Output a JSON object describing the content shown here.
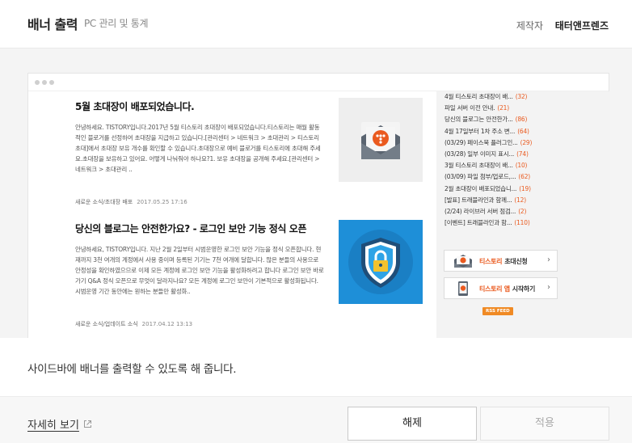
{
  "header": {
    "title": "배너 출력",
    "subtitle": "PC 관리 및 통계",
    "maker_label": "제작자",
    "maker_name": "태터앤프렌즈"
  },
  "preview": {
    "posts": [
      {
        "title": "5월 초대장이 배포되었습니다.",
        "body": "안녕하세요. TISTORY입니다.2017년 5월 티스토리 초대장이 배포되었습니다.티스토리는 매월 활동적인 블로거를 선정하여 초대장을 지급하고 있습니다.[관리센터 > 네트워크 > 초대관리 > 티스토리 초대]에서 초대장 보유 개수를 확인할 수 있습니다.초대장으로 예비 블로거를 티스토리에 초대해 주세요.초대장을 보유하고 있어요. 어떻게 나눠줘야 하나요?1. 보유 초대장을 공개해 주세요.[관리센터 > 네트워크 > 초대관리 ..",
        "category": "새로운 소식/초대장 배포",
        "date": "2017.05.25 17:16",
        "thumb_icon": "envelope-icon",
        "thumb_bg": "#eeeeee"
      },
      {
        "title": "당신의 블로그는 안전한가요? - 로그인 보안 기능 정식 오픈",
        "body": "안녕하세요, TISTORY입니다. 지난 2월 2일부터 시범운영한 로그인 보안 기능을 정식 오픈합니다. 현재까지 3천 여개의 계정에서 사용 중이며 등록된 기기는 7천 여개에 달합니다. 많은 분들의 사용으로 안정성을 확인하였으므로 이제 모든 계정에 로그인 보안 기능을 활성화하려고 합니다 로그인 보안 바로가기 Q&A 정식 오픈으로 무엇이 달라지나요? 모든 계정에 로그인 보안이 기본적으로 활성화됩니다. 시범운영 기간 동안에는 원하는 분들만 활성화..",
        "category": "새로운 소식/업데이트 소식",
        "date": "2017.04.12 13:13",
        "thumb_icon": "shield-lock-icon",
        "thumb_bg": "#1e8fd8"
      }
    ],
    "sidebar_list": [
      {
        "text": "4월 티스토리 초대장이 배...",
        "count": "(32)"
      },
      {
        "text": "파일 서버 이전 안내.",
        "count": "(21)"
      },
      {
        "text": "당신의 블로그는 안전한가...",
        "count": "(86)"
      },
      {
        "text": "4월 17일부터 1차 주소 변...",
        "count": "(64)"
      },
      {
        "text": "(03/29) 페이스북 플러그인...",
        "count": "(29)"
      },
      {
        "text": "(03/28) 일부 이미지 표시...",
        "count": "(74)"
      },
      {
        "text": "3월 티스토리 초대장이 배...",
        "count": "(10)"
      },
      {
        "text": "(03/09) 파일 첨부/업로드,...",
        "count": "(62)"
      },
      {
        "text": "2월 초대장이 배포되었습니...",
        "count": "(19)"
      },
      {
        "text": "[발표] 트래블라인과 함께...",
        "count": "(12)"
      },
      {
        "text": "(2/24) 라이브러 서버 점검...",
        "count": "(2)"
      },
      {
        "text": "[이벤트] 트래블라인과 함...",
        "count": "(110)"
      }
    ],
    "banner_invite": {
      "brand": "티스토리",
      "text": "초대신청"
    },
    "banner_app": {
      "brand": "티스토리 앱",
      "text": "시작하기"
    },
    "rss_label": "RSS FEED",
    "accent_color": "#ea5a1f"
  },
  "description": "사이드바에 배너를 출력할 수 있도록 해 줍니다.",
  "footer": {
    "more_link": "자세히 보기",
    "cancel_label": "해제",
    "apply_label": "적용"
  }
}
